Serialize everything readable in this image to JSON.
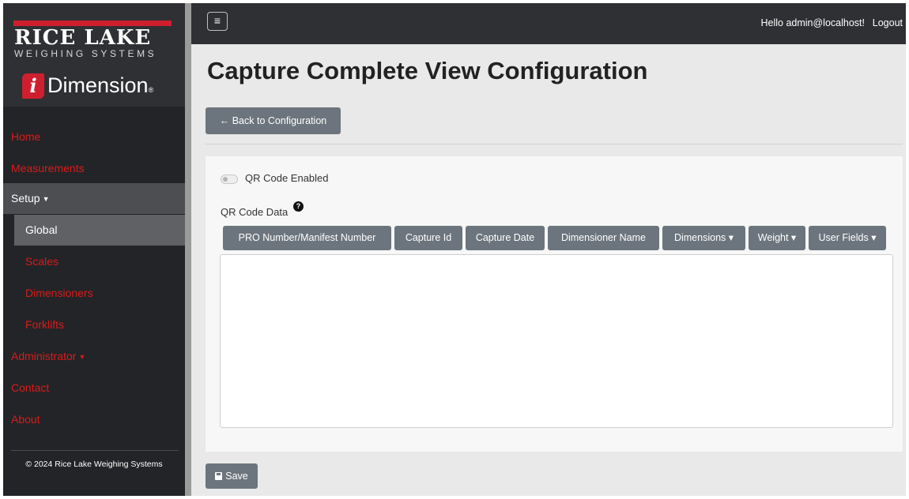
{
  "brand": {
    "company": "RICE LAKE",
    "tagline": "WEIGHING SYSTEMS",
    "product_icon_letter": "i",
    "product_name": "Dimension",
    "trademark": "®",
    "accent_color": "#cf1f2e"
  },
  "sidebar": {
    "items": [
      {
        "label": "Home"
      },
      {
        "label": "Measurements"
      },
      {
        "label": "Setup"
      },
      {
        "label": "Global"
      },
      {
        "label": "Scales"
      },
      {
        "label": "Dimensioners"
      },
      {
        "label": "Forklifts"
      },
      {
        "label": "Administrator"
      },
      {
        "label": "Contact"
      },
      {
        "label": "About"
      }
    ],
    "caret": "▼",
    "footer": "© 2024 Rice Lake Weighing Systems"
  },
  "topbar": {
    "menu_icon": "≡",
    "greeting": "Hello admin@localhost!",
    "logout": "Logout"
  },
  "main": {
    "title": "Capture Complete View Configuration",
    "back_button": "← Back to Configuration",
    "qr_toggle_label": "QR Code Enabled",
    "qr_toggle_on": false,
    "qr_data_label": "QR Code Data",
    "help_icon": "?",
    "field_buttons": [
      {
        "label": "PRO Number/Manifest Number"
      },
      {
        "label": "Capture Id"
      },
      {
        "label": "Capture Date"
      },
      {
        "label": "Dimensioner Name"
      },
      {
        "label": "Dimensions ▾"
      },
      {
        "label": "Weight ▾"
      },
      {
        "label": "User Fields ▾"
      }
    ],
    "qr_textarea_value": "",
    "save_button": "Save"
  }
}
